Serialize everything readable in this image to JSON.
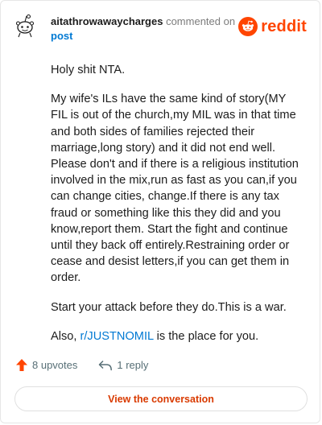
{
  "comment": {
    "username": "aitathrowawaycharges",
    "action_text": "commented on",
    "post_link": "post",
    "paragraphs": [
      "Holy shit NTA.",
      "My wife's ILs have the same kind of story(MY FIL is out of the church,my MIL was in that time and both sides of families rejected their marriage,long story) and it did not end well. Please don't and if there is a religious institution involved in the mix,run as fast as you can,if you can change cities, change.If there is any tax fraud or something like this they did and you know,report them. Start the fight and continue until they back off entirely.Restraining order or cease and desist letters,if you can get them in order.",
      "Start your attack before they do.This is a war."
    ],
    "last_paragraph": {
      "prefix": "Also, ",
      "link": "r/JUSTNOMIL",
      "suffix": " is the place for you."
    }
  },
  "brand": {
    "name": "reddit",
    "color": "#ff4500"
  },
  "footer": {
    "upvotes": "8 upvotes",
    "replies": "1 reply",
    "upvote_icon": "upvote-arrow-icon",
    "reply_icon": "reply-arrow-icon"
  },
  "cta": {
    "label": "View the conversation"
  },
  "colors": {
    "accent": "#ff4500",
    "link": "#0079d3",
    "cta_text": "#d93a00"
  }
}
